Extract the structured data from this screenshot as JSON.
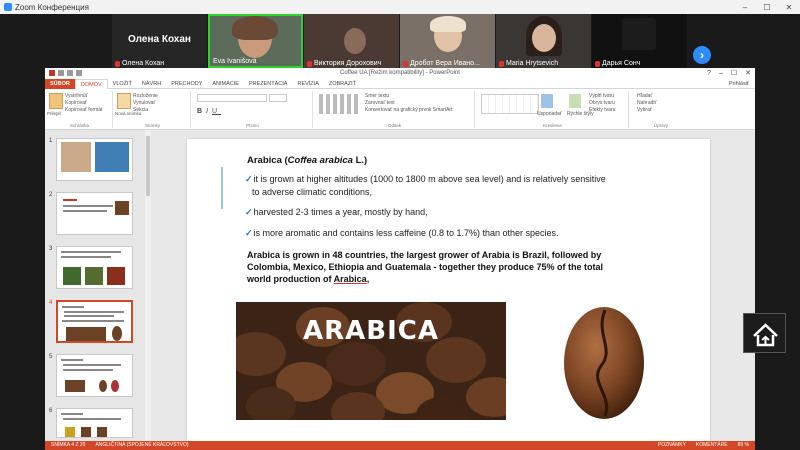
{
  "zoom": {
    "window_title": "Zoom Конференция",
    "participants": [
      {
        "name": "Олена Кохан",
        "tile_label": "Олена Кохан",
        "active": false
      },
      {
        "name": "Eva Ivanišová",
        "active": true
      },
      {
        "name": "Виктория Дорохович",
        "active": false
      },
      {
        "name": "Дробот Вера Ивано...",
        "active": false
      },
      {
        "name": "Maria Hrytsevich",
        "active": false
      },
      {
        "name": "Дарья Сонч",
        "active": false
      }
    ],
    "next_icon": "chevron-right-icon",
    "accent": "#2d8cff"
  },
  "ppt": {
    "title": "Coffee UA [Režim kompatibility] - PowerPoint",
    "tabs": [
      "SÚBOR",
      "DOMOV",
      "VLOŽIŤ",
      "NÁVRH",
      "PRECHODY",
      "ANIMÁCIE",
      "PREZENTÁCIA",
      "REVÍZIA",
      "ZOBRAZIŤ"
    ],
    "user": "Prihlásiť",
    "ribbon": {
      "clipboard": {
        "paste": "Prilepiť",
        "cut": "Vystrihnúť",
        "copy": "Kopírovať",
        "format": "Kopírovať formát",
        "label": "Schránka"
      },
      "slides": {
        "new": "Nová snímka",
        "layout": "Rozloženie",
        "reset": "Vynulovať",
        "section": "Sekcia",
        "label": "Snímky"
      },
      "font": {
        "label": "Písmo"
      },
      "paragraph": {
        "dir": "Smer textu",
        "align": "Zarovnať text",
        "smart": "Konvertovať na grafický prvok SmartArt",
        "label": "Odsek"
      },
      "drawing": {
        "arrange": "Usporiadať",
        "styles": "Rýchle štýly",
        "fill": "Výplň tvaru",
        "outline": "Obrys tvaru",
        "effects": "Efekty tvaru",
        "label": "Kreslenie"
      },
      "editing": {
        "find": "Hľadať",
        "replace": "Nahradiť",
        "select": "Vybrať",
        "label": "Úpravy"
      }
    },
    "accent": "#d24726",
    "thumbnails": [
      1,
      2,
      3,
      4,
      5,
      6
    ],
    "selected_slide": 4,
    "status": {
      "slide": "SNÍMKA 4 Z 20",
      "lang": "ANGLIČTINA (SPOJENÉ KRÁĽOVSTVO)",
      "notes": "POZNÁMKY",
      "comments": "KOMENTÁRE",
      "zoom": "89 %"
    }
  },
  "slide": {
    "title_plain": "Arabica (",
    "title_italic": "Coffea arabica",
    "title_end": " L.)",
    "bullets": [
      "it is grown at higher altitudes (1000 to 1800 m above sea level) and is relatively sensitive",
      "to adverse climatic conditions,",
      "harvested 2-3 times a year, mostly by hand,",
      "is more aromatic and contains less caffeine (0.8 to 1.7%) than other species."
    ],
    "para_1": "Arabica is grown in 48 countries, the largest grower of Arabia is Brazil, followed by",
    "para_2": "Colombia, Mexico, Ethiopia and Guatemala - together they produce 75% of the total",
    "para_3a": "world production of ",
    "para_3b": "Arabica",
    "para_3c": ",",
    "photo_caption": "ARABICA"
  }
}
